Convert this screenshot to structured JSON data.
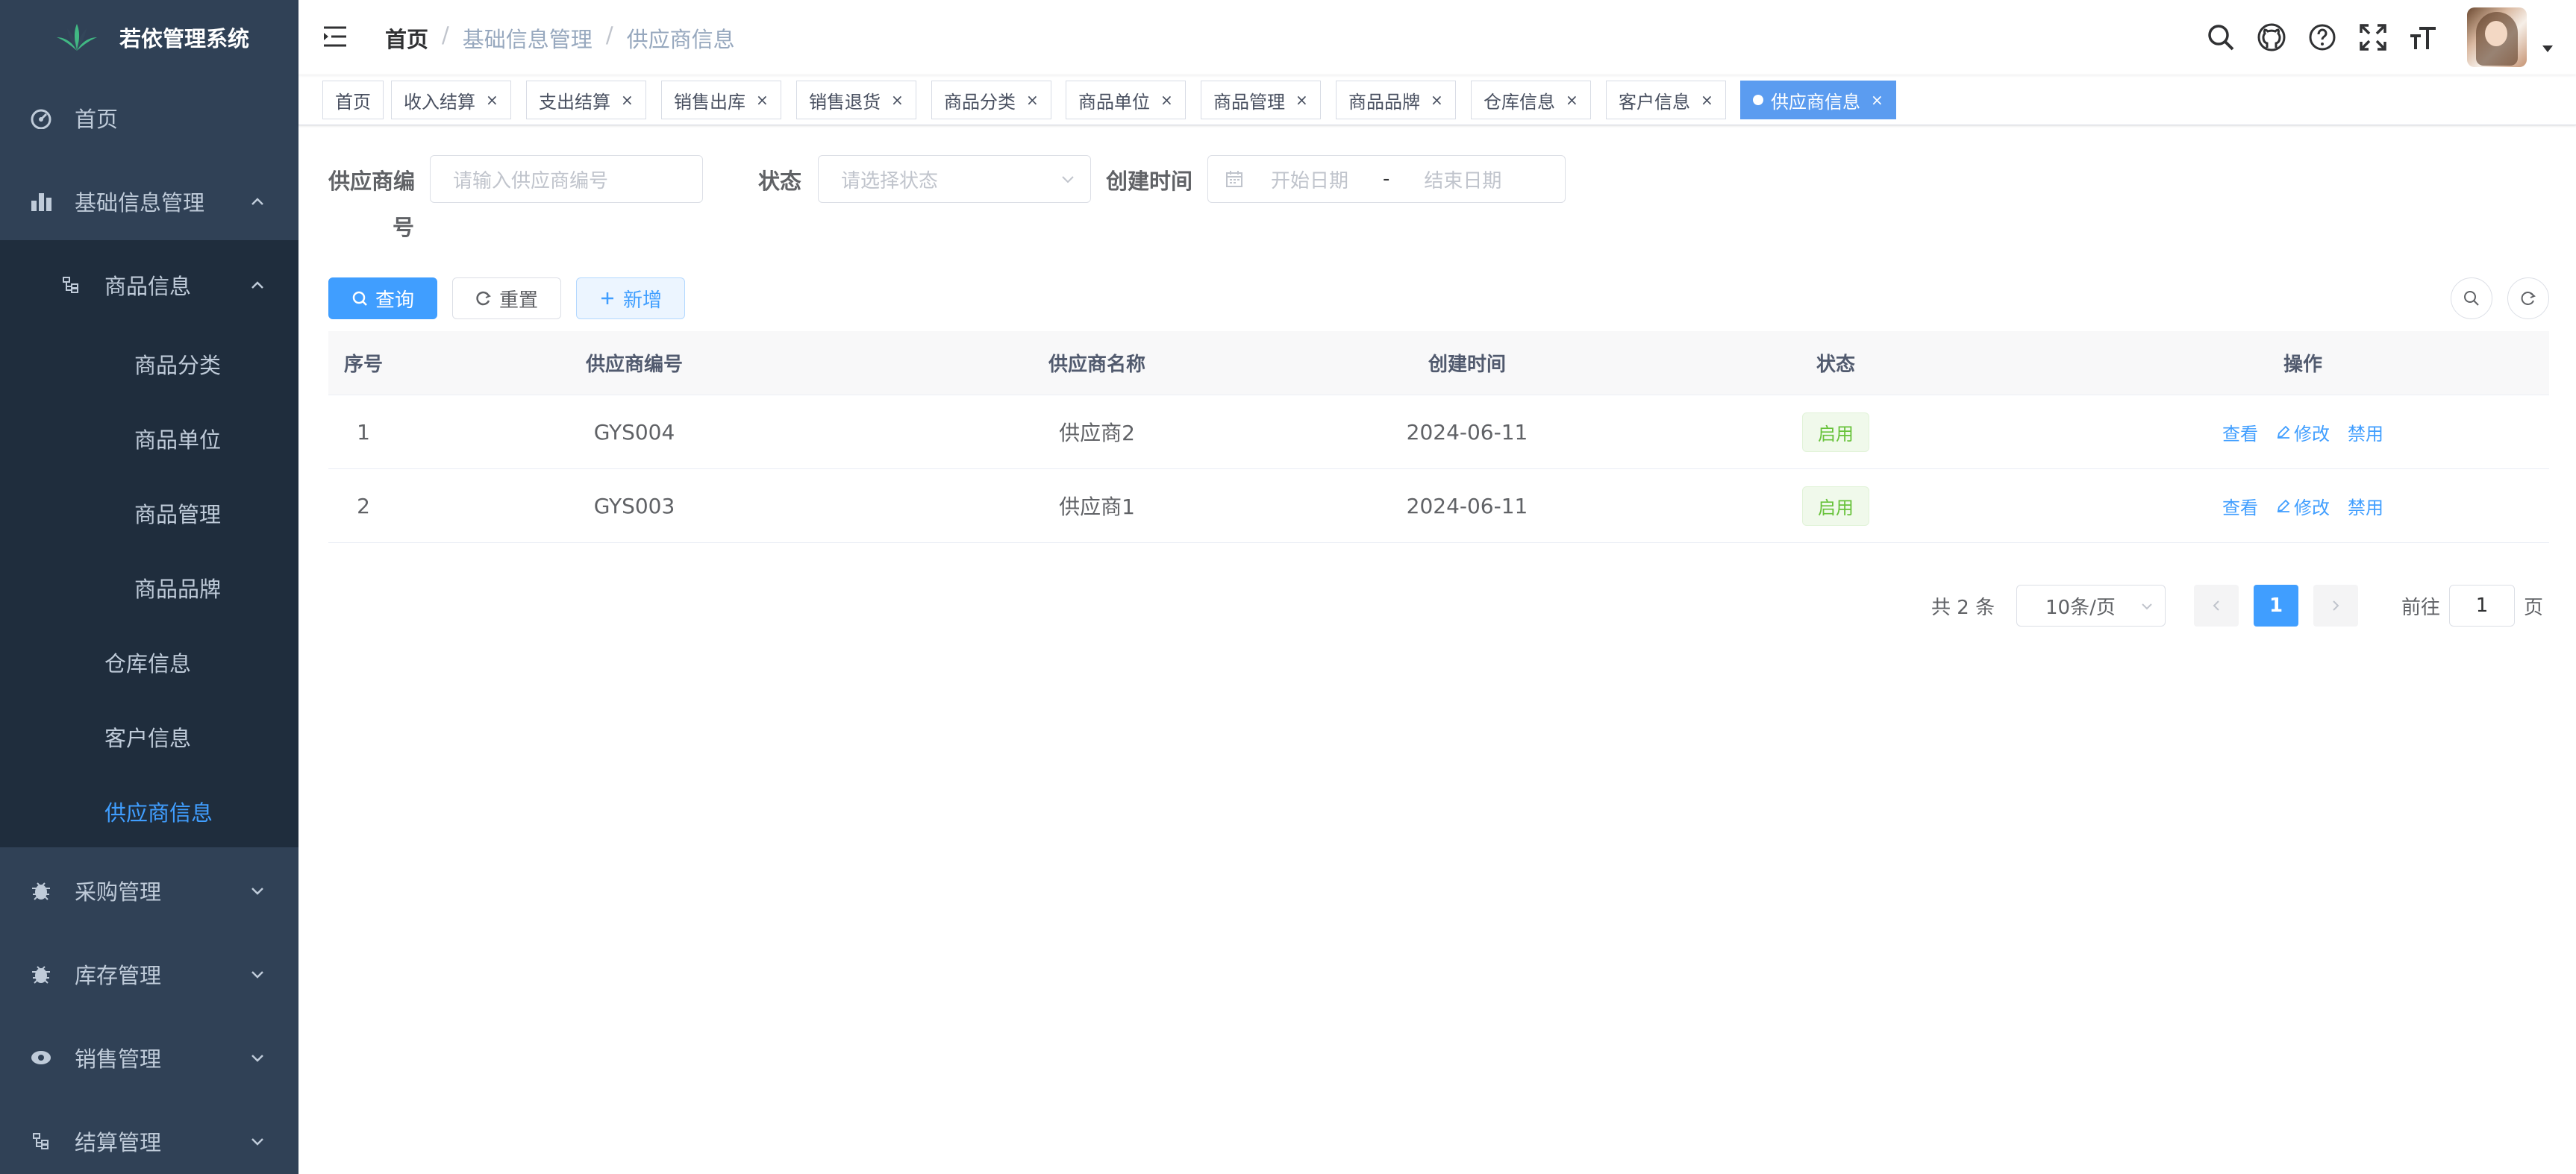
{
  "app": {
    "title": "若依管理系统"
  },
  "sidebar": {
    "items": [
      {
        "label": "首页",
        "icon": "dashboard-icon"
      },
      {
        "label": "基础信息管理",
        "icon": "chart-icon"
      },
      {
        "label": "采购管理",
        "icon": "bug-icon"
      },
      {
        "label": "库存管理",
        "icon": "bug-icon"
      },
      {
        "label": "销售管理",
        "icon": "eye-icon"
      },
      {
        "label": "结算管理",
        "icon": "tree-icon"
      }
    ],
    "sub_group": {
      "label": "商品信息",
      "icon": "tree-icon"
    },
    "sub_items": [
      "商品分类",
      "商品单位",
      "商品管理",
      "商品品牌"
    ],
    "level2_items": [
      "仓库信息",
      "客户信息",
      "供应商信息"
    ]
  },
  "breadcrumb": [
    "首页",
    "基础信息管理",
    "供应商信息"
  ],
  "tags": [
    "首页",
    "收入结算",
    "支出结算",
    "销售出库",
    "销售退货",
    "商品分类",
    "商品单位",
    "商品管理",
    "商品品牌",
    "仓库信息",
    "客户信息",
    "供应商信息"
  ],
  "search_form": {
    "supplier_code_label_line1": "供应商编",
    "supplier_code_label_line2": "号",
    "supplier_code_placeholder": "请输入供应商编号",
    "status_label": "状态",
    "status_placeholder": "请选择状态",
    "created_label": "创建时间",
    "date_start_placeholder": "开始日期",
    "date_separator": "-",
    "date_end_placeholder": "结束日期"
  },
  "toolbar": {
    "search": "查询",
    "reset": "重置",
    "add": "新增"
  },
  "table": {
    "columns": [
      "序号",
      "供应商编号",
      "供应商名称",
      "创建时间",
      "状态",
      "操作"
    ],
    "rows": [
      {
        "index": "1",
        "code": "GYS004",
        "name": "供应商2",
        "created": "2024-06-11",
        "status": "启用"
      },
      {
        "index": "2",
        "code": "GYS003",
        "name": "供应商1",
        "created": "2024-06-11",
        "status": "启用"
      }
    ],
    "actions": {
      "view": "查看",
      "edit": "修改",
      "disable": "禁用"
    }
  },
  "pagination": {
    "total": "共 2 条",
    "page_size": "10条/页",
    "current_page": "1",
    "goto_label": "前往",
    "goto_value": "1",
    "page_suffix": "页"
  },
  "colors": {
    "sidebar": "#304156",
    "submenu": "#1f2d3d",
    "primary": "#409eff",
    "active_tag": "#5b9cf0",
    "success": "#67c23a"
  }
}
